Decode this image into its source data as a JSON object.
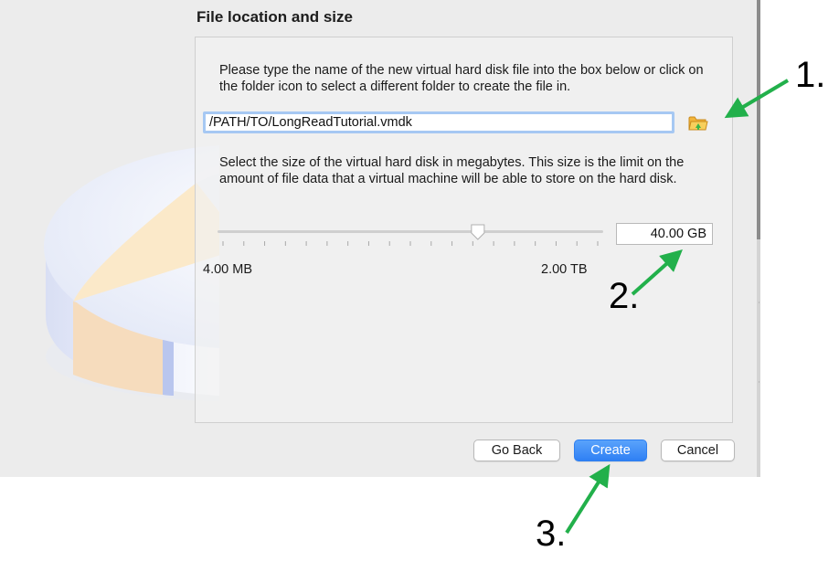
{
  "section_title": "File location and size",
  "location_description": "Please type the name of the new virtual hard disk file into the box below or click on the folder icon to select a different folder to create the file in.",
  "file_path": "/PATH/TO/LongReadTutorial.vmdk",
  "size_description": "Select the size of the virtual hard disk in megabytes. This size is the limit on the amount of file data that a virtual machine will be able to store on the hard disk.",
  "size": {
    "value": "40.00 GB",
    "min_label": "4.00 MB",
    "max_label": "2.00 TB",
    "slider_fraction": 0.675
  },
  "buttons": {
    "back": "Go Back",
    "create": "Create",
    "cancel": "Cancel"
  },
  "annotations": [
    "1.",
    "2.",
    "3."
  ],
  "colors": {
    "arrow": "#22b04b",
    "primary_button": "#2f80f4",
    "focus_ring": "#a6c8f3"
  },
  "icons": {
    "folder": "folder-open-icon",
    "disk": "hard-disk-illustration"
  }
}
